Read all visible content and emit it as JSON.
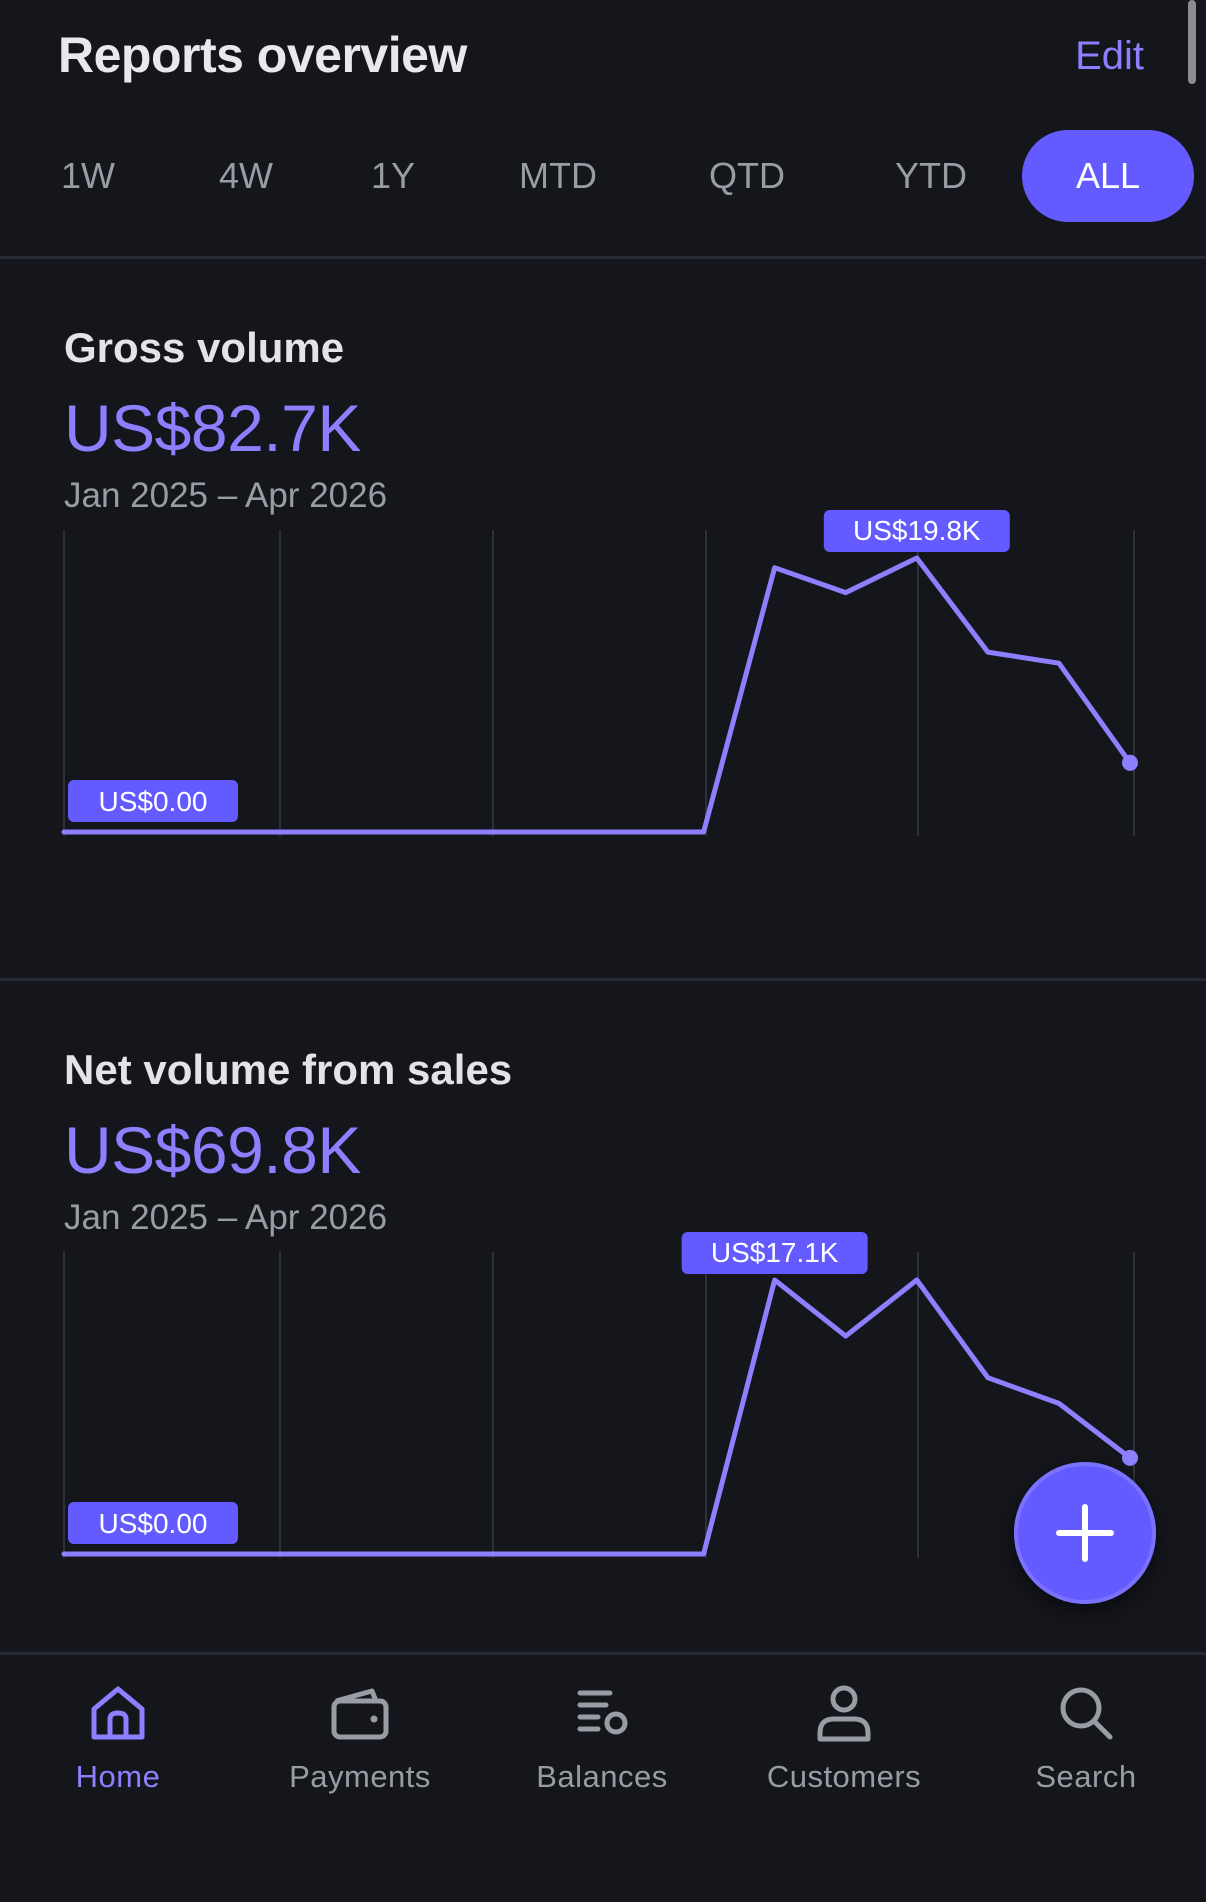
{
  "header": {
    "title": "Reports overview",
    "edit_label": "Edit"
  },
  "periods": {
    "items": [
      "1W",
      "4W",
      "1Y",
      "MTD",
      "QTD",
      "YTD",
      "ALL"
    ],
    "selected": "ALL"
  },
  "cards": [
    {
      "title": "Gross volume",
      "value": "US$82.7K",
      "range": "Jan 2025 – Apr 2026",
      "min_label": "US$0.00",
      "max_label": "US$19.8K"
    },
    {
      "title": "Net volume from sales",
      "value": "US$69.8K",
      "range": "Jan 2025 – Apr 2026",
      "min_label": "US$0.00",
      "max_label": "US$17.1K"
    }
  ],
  "chart_data": [
    {
      "type": "line",
      "series": [
        {
          "values": [
            0,
            0,
            0,
            0,
            0,
            0,
            0,
            0,
            0,
            0,
            19100,
            17300,
            19800,
            13000,
            12200,
            5000
          ]
        }
      ],
      "ylim": [
        0,
        19800
      ],
      "grid": "vertical",
      "color": "#8c80ff"
    },
    {
      "type": "line",
      "series": [
        {
          "values": [
            0,
            0,
            0,
            0,
            0,
            0,
            0,
            0,
            0,
            0,
            17100,
            13600,
            17100,
            11000,
            9400,
            6000
          ]
        }
      ],
      "ylim": [
        0,
        17100
      ],
      "grid": "vertical",
      "color": "#8c80ff"
    }
  ],
  "nav": {
    "items": [
      {
        "label": "Home",
        "icon": "home-icon",
        "active": true
      },
      {
        "label": "Payments",
        "icon": "wallet-icon",
        "active": false
      },
      {
        "label": "Balances",
        "icon": "balances-icon",
        "active": false
      },
      {
        "label": "Customers",
        "icon": "person-icon",
        "active": false
      },
      {
        "label": "Search",
        "icon": "search-icon",
        "active": false
      }
    ]
  },
  "fab": {
    "icon": "plus-icon"
  },
  "colors": {
    "accent": "#635bff",
    "accent_text": "#8c80ff",
    "background": "#14161c",
    "muted": "#9a9ca3"
  }
}
